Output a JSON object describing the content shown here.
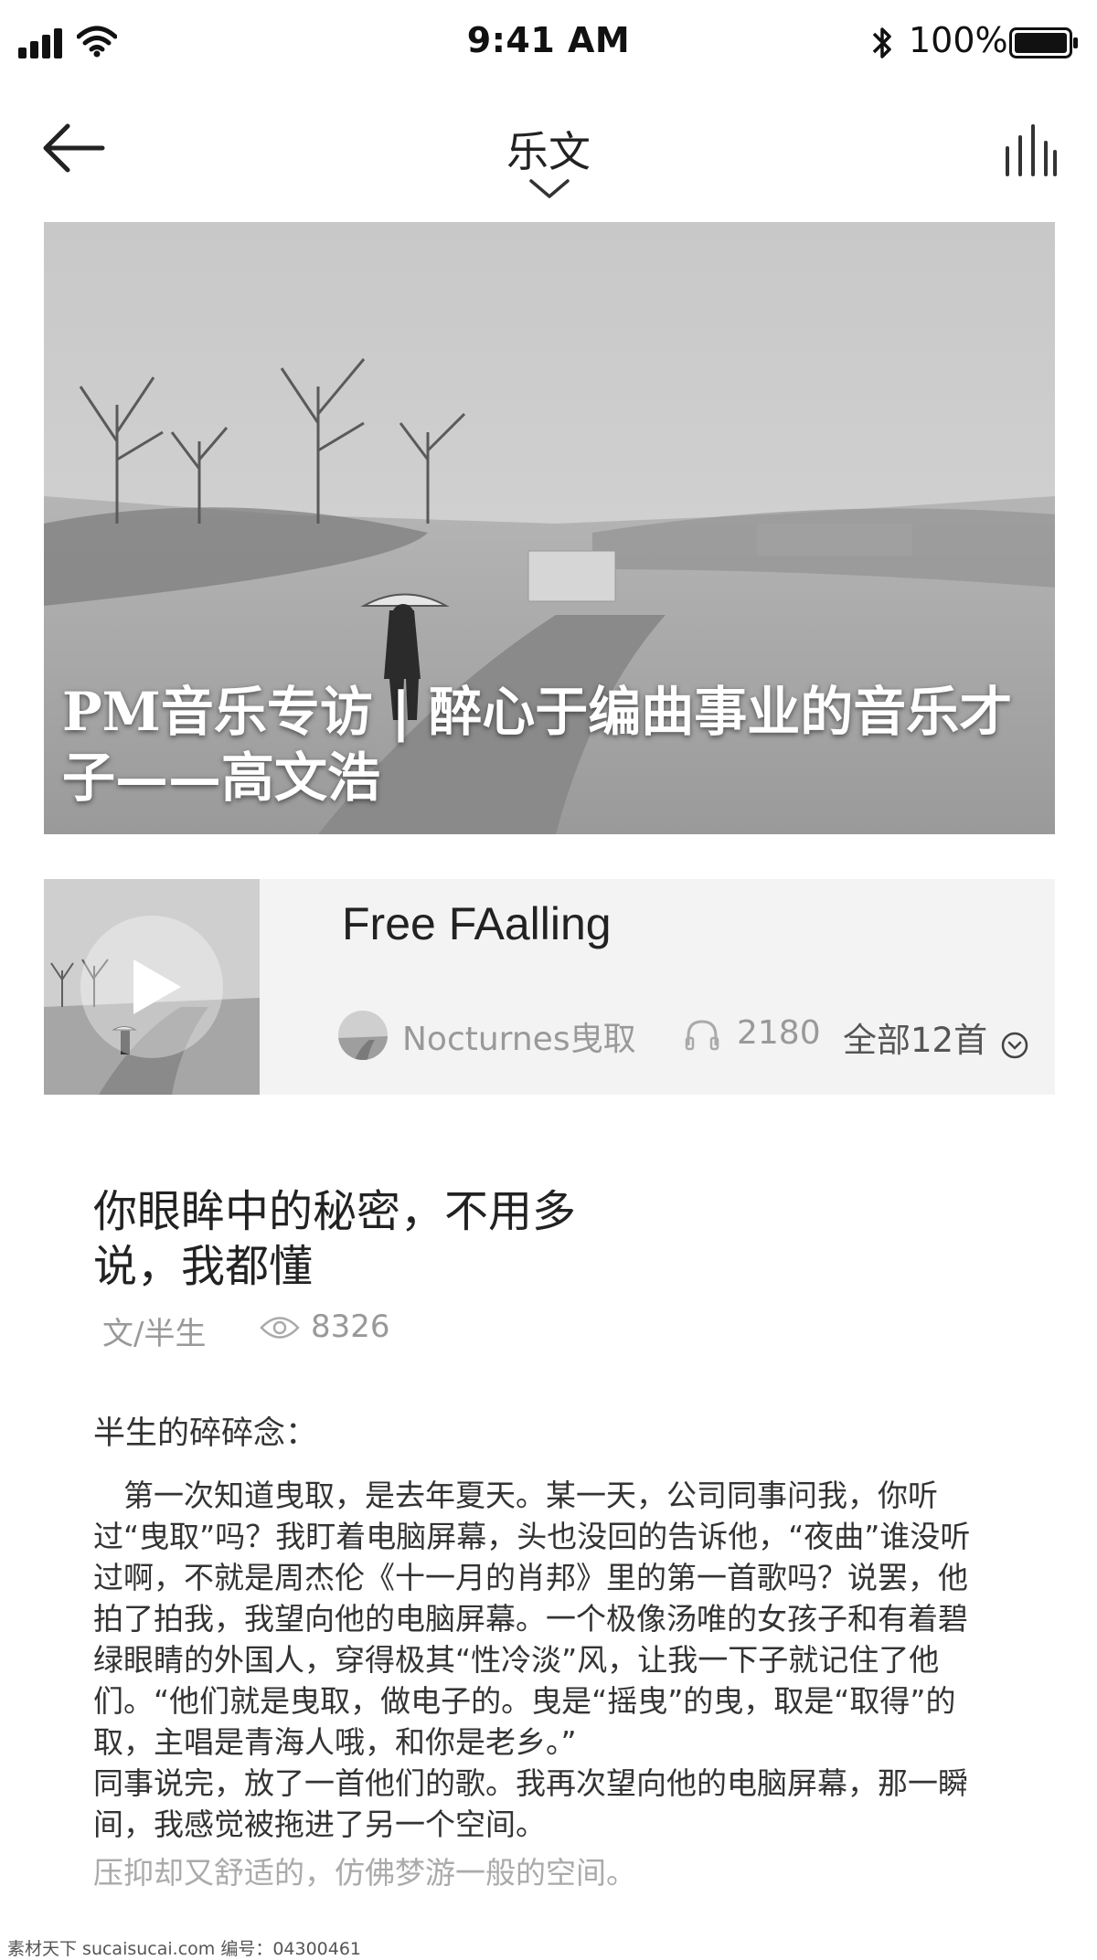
{
  "status_bar": {
    "time": "9:41 AM",
    "battery": "100%"
  },
  "nav": {
    "title": "乐文"
  },
  "hero": {
    "title": "PM音乐专访 | 醉心于编曲事业的音乐才子——高文浩"
  },
  "music_card": {
    "song_title": "Free FAalling",
    "artist": "Nocturnes曳取",
    "play_count": "2180",
    "all_songs_label": "全部12首"
  },
  "article": {
    "title": "你眼眸中的秘密，不用多说，我都懂",
    "author": "文/半生",
    "views": "8326",
    "section_heading": "半生的碎碎念：",
    "paragraphs": [
      "　第一次知道曳取，是去年夏天。某一天，公司同事问我，你听过“曳取”吗？我盯着电脑屏幕，头也没回的告诉他，“夜曲”谁没听过啊，不就是周杰伦《十一月的肖邦》里的第一首歌吗？说罢，他拍了拍我，我望向他的电脑屏幕。一个极像汤唯的女孩子和有着碧绿眼睛的外国人，穿得极其“性冷淡”风，让我一下子就记住了他们。“他们就是曳取，做电子的。曳是“摇曳”的曳，取是“取得”的取，主唱是青海人哦，和你是老乡。”",
      "同事说完，放了一首他们的歌。我再次望向他的电脑屏幕，那一瞬间，我感觉被拖进了另一个空间。"
    ],
    "faded_line": "压抑却又舒适的，仿佛梦游一般的空间。"
  },
  "watermark": {
    "text": "素材天下 sucaisucai.com  编号：04300461"
  }
}
